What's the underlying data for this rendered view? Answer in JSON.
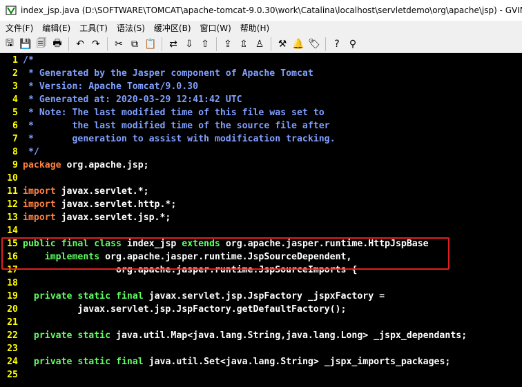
{
  "window": {
    "title": "index_jsp.java (D:\\SOFTWARE\\TOMCAT\\apache-tomcat-9.0.30\\work\\Catalina\\localhost\\servletdemo\\org\\apache\\jsp) - GVIM"
  },
  "menu": [
    "文件(F)",
    "编辑(E)",
    "工具(T)",
    "语法(S)",
    "缓冲区(B)",
    "窗口(W)",
    "帮助(H)"
  ],
  "toolbar": {
    "groups": [
      [
        "open-icon",
        "save-icon",
        "save-all-icon",
        "print-icon"
      ],
      [
        "undo-icon",
        "redo-icon"
      ],
      [
        "cut-icon",
        "copy-icon",
        "paste-icon"
      ],
      [
        "replace-icon",
        "find-next-icon",
        "find-prev-icon"
      ],
      [
        "load-session-icon",
        "save-session-icon",
        "run-script-icon"
      ],
      [
        "make-icon",
        "run-shell-icon",
        "tag-jump-icon"
      ],
      [
        "help-icon",
        "find-help-icon"
      ]
    ],
    "glyphs": [
      "🖫",
      "💾",
      "🗐",
      "🖶",
      "↶",
      "↷",
      "✂",
      "⧉",
      "📋",
      "⇄",
      "⇩",
      "⇧",
      "⇪",
      "⇫",
      "♙",
      "⚒",
      "🔔",
      "🏷",
      "?",
      "⚲"
    ]
  },
  "colors": {
    "background": "#000000",
    "line_number": "#ffff00",
    "comment": "#80a0ff",
    "keyword": "#ff8040",
    "type": "#60ff60",
    "text": "#ffffff",
    "highlight_border": "#e02020"
  },
  "code_lines": [
    {
      "n": "1",
      "tokens": [
        {
          "t": "/*",
          "c": "comment"
        }
      ]
    },
    {
      "n": "2",
      "tokens": [
        {
          "t": " * Generated by the Jasper component of Apache Tomcat",
          "c": "comment"
        }
      ]
    },
    {
      "n": "3",
      "tokens": [
        {
          "t": " * Version: Apache Tomcat/9.0.30",
          "c": "comment"
        }
      ]
    },
    {
      "n": "4",
      "tokens": [
        {
          "t": " * Generated at: 2020-03-29 12:41:42 UTC",
          "c": "comment"
        }
      ]
    },
    {
      "n": "5",
      "tokens": [
        {
          "t": " * Note: The last modified time of this file was set to",
          "c": "comment"
        }
      ]
    },
    {
      "n": "6",
      "tokens": [
        {
          "t": " *       the last modified time of the source file after",
          "c": "comment"
        }
      ]
    },
    {
      "n": "7",
      "tokens": [
        {
          "t": " *       generation to assist with modification tracking.",
          "c": "comment"
        }
      ]
    },
    {
      "n": "8",
      "tokens": [
        {
          "t": " */",
          "c": "comment"
        }
      ]
    },
    {
      "n": "9",
      "tokens": [
        {
          "t": "package",
          "c": "keyword"
        },
        {
          "t": " org.apache.jsp;",
          "c": "text"
        }
      ]
    },
    {
      "n": "10",
      "tokens": []
    },
    {
      "n": "11",
      "tokens": [
        {
          "t": "import",
          "c": "keyword"
        },
        {
          "t": " javax.servlet.*;",
          "c": "text"
        }
      ]
    },
    {
      "n": "12",
      "tokens": [
        {
          "t": "import",
          "c": "keyword"
        },
        {
          "t": " javax.servlet.http.*;",
          "c": "text"
        }
      ]
    },
    {
      "n": "13",
      "tokens": [
        {
          "t": "import",
          "c": "keyword"
        },
        {
          "t": " javax.servlet.jsp.*;",
          "c": "text"
        }
      ]
    },
    {
      "n": "14",
      "tokens": []
    },
    {
      "n": "15",
      "tokens": [
        {
          "t": "public",
          "c": "type"
        },
        {
          "t": " ",
          "c": "text"
        },
        {
          "t": "final",
          "c": "type"
        },
        {
          "t": " ",
          "c": "text"
        },
        {
          "t": "class",
          "c": "type"
        },
        {
          "t": " index_jsp ",
          "c": "text"
        },
        {
          "t": "extends",
          "c": "type"
        },
        {
          "t": " org.apache.jasper.runtime.HttpJspBase",
          "c": "text"
        }
      ]
    },
    {
      "n": "16",
      "tokens": [
        {
          "t": "    ",
          "c": "text"
        },
        {
          "t": "implements",
          "c": "type"
        },
        {
          "t": " org.apache.jasper.runtime.JspSourceDependent,",
          "c": "text"
        }
      ]
    },
    {
      "n": "17",
      "tokens": [
        {
          "t": "                 org.apache.jasper.runtime.JspSourceImports {",
          "c": "text"
        }
      ]
    },
    {
      "n": "18",
      "tokens": []
    },
    {
      "n": "19",
      "tokens": [
        {
          "t": "  ",
          "c": "text"
        },
        {
          "t": "private",
          "c": "type"
        },
        {
          "t": " ",
          "c": "text"
        },
        {
          "t": "static",
          "c": "type"
        },
        {
          "t": " ",
          "c": "text"
        },
        {
          "t": "final",
          "c": "type"
        },
        {
          "t": " javax.servlet.jsp.JspFactory _jspxFactory =",
          "c": "text"
        }
      ]
    },
    {
      "n": "20",
      "tokens": [
        {
          "t": "          javax.servlet.jsp.JspFactory.getDefaultFactory();",
          "c": "text"
        }
      ]
    },
    {
      "n": "21",
      "tokens": []
    },
    {
      "n": "22",
      "tokens": [
        {
          "t": "  ",
          "c": "text"
        },
        {
          "t": "private",
          "c": "type"
        },
        {
          "t": " ",
          "c": "text"
        },
        {
          "t": "static",
          "c": "type"
        },
        {
          "t": " java.util.Map<java.lang.String,java.lang.Long> _jspx_dependants;",
          "c": "text"
        }
      ]
    },
    {
      "n": "23",
      "tokens": []
    },
    {
      "n": "24",
      "tokens": [
        {
          "t": "  ",
          "c": "text"
        },
        {
          "t": "private",
          "c": "type"
        },
        {
          "t": " ",
          "c": "text"
        },
        {
          "t": "static",
          "c": "type"
        },
        {
          "t": " ",
          "c": "text"
        },
        {
          "t": "final",
          "c": "type"
        },
        {
          "t": " java.util.Set<java.lang.String> _jspx_imports_packages;",
          "c": "text"
        }
      ]
    },
    {
      "n": "25",
      "tokens": []
    }
  ]
}
